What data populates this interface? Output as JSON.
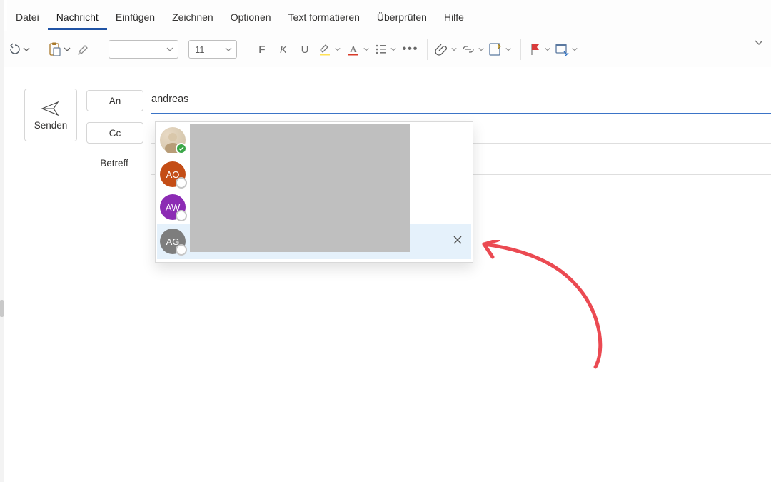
{
  "tabs": {
    "file": "Datei",
    "message": "Nachricht",
    "insert": "Einfügen",
    "draw": "Zeichnen",
    "options": "Optionen",
    "format": "Text formatieren",
    "review": "Überprüfen",
    "help": "Hilfe"
  },
  "ribbon": {
    "font_name": "",
    "font_size": "11",
    "bold": "F",
    "italic": "K",
    "underline": "U",
    "more": "•••"
  },
  "compose": {
    "send": "Senden",
    "to_btn": "An",
    "cc_btn": "Cc",
    "subject": "Betreff",
    "to_value": "andreas"
  },
  "suggestions": {
    "items": [
      {
        "initials": "",
        "type": "photo",
        "presence": "available"
      },
      {
        "initials": "AO",
        "type": "init",
        "color": "ao",
        "presence": "none"
      },
      {
        "initials": "AW",
        "type": "init",
        "color": "aw",
        "presence": "none"
      },
      {
        "initials": "AG",
        "type": "init",
        "color": "ag",
        "presence": "none",
        "selected": true
      }
    ]
  },
  "colors": {
    "accent": "#2053a5",
    "annotation": "#eb4a52"
  }
}
